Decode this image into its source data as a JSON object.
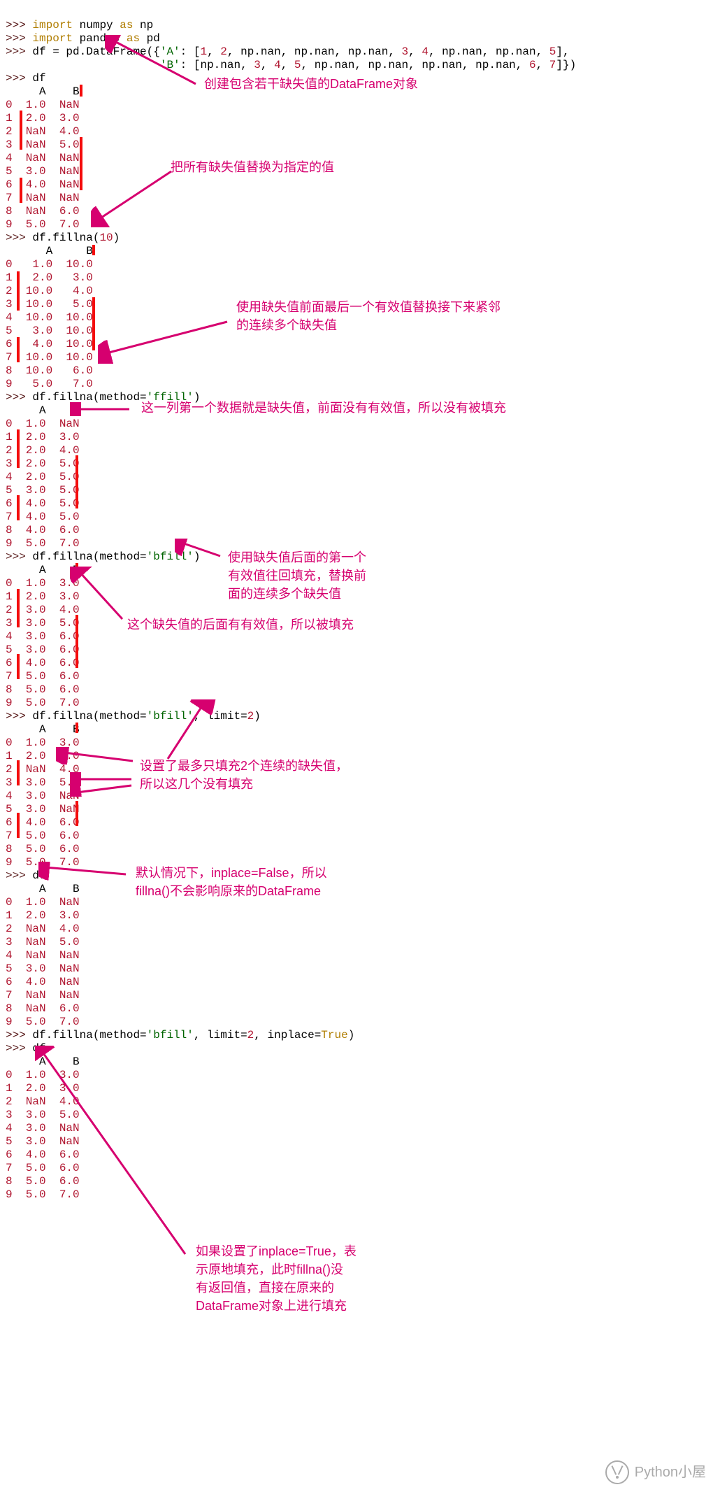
{
  "code": {
    "line01": ">>> import numpy as np",
    "line02": ">>> import pandas as pd",
    "line03a": ">>> df = pd.DataFrame({'A': [1, 2, np.nan, np.nan, np.nan, 3, 4, np.nan, np.nan, 5],",
    "line03b": "                       'B': [np.nan, 3, 4, 5, np.nan, np.nan, np.nan, np.nan, 6, 7]})",
    "cmd_df": ">>> df",
    "cmd_fillna10": ">>> df.fillna(10)",
    "cmd_ffill": ">>> df.fillna(method='ffill')",
    "cmd_bfill": ">>> df.fillna(method='bfill')",
    "cmd_bfill_lim": ">>> df.fillna(method='bfill', limit=2)",
    "cmd_bfill_inplace": ">>> df.fillna(method='bfill', limit=2, inplace=True)"
  },
  "tables": {
    "df_orig": {
      "header": "     A    B",
      "rows": [
        "0  1.0  NaN",
        "1  2.0  3.0",
        "2  NaN  4.0",
        "3  NaN  5.0",
        "4  NaN  NaN",
        "5  3.0  NaN",
        "6  4.0  NaN",
        "7  NaN  NaN",
        "8  NaN  6.0",
        "9  5.0  7.0"
      ]
    },
    "df_fill10": {
      "header": "      A     B",
      "rows": [
        "0   1.0  10.0",
        "1   2.0   3.0",
        "2  10.0   4.0",
        "3  10.0   5.0",
        "4  10.0  10.0",
        "5   3.0  10.0",
        "6   4.0  10.0",
        "7  10.0  10.0",
        "8  10.0   6.0",
        "9   5.0   7.0"
      ]
    },
    "df_ffill": {
      "header": "     A    B",
      "rows": [
        "0  1.0  NaN",
        "1  2.0  3.0",
        "2  2.0  4.0",
        "3  2.0  5.0",
        "4  2.0  5.0",
        "5  3.0  5.0",
        "6  4.0  5.0",
        "7  4.0  5.0",
        "8  4.0  6.0",
        "9  5.0  7.0"
      ]
    },
    "df_bfill": {
      "header": "     A    B",
      "rows": [
        "0  1.0  3.0",
        "1  2.0  3.0",
        "2  3.0  4.0",
        "3  3.0  5.0",
        "4  3.0  6.0",
        "5  3.0  6.0",
        "6  4.0  6.0",
        "7  5.0  6.0",
        "8  5.0  6.0",
        "9  5.0  7.0"
      ]
    },
    "df_bfill_lim": {
      "header": "     A    B",
      "rows": [
        "0  1.0  3.0",
        "1  2.0  3.0",
        "2  NaN  4.0",
        "3  3.0  5.0",
        "4  3.0  NaN",
        "5  3.0  NaN",
        "6  4.0  6.0",
        "7  5.0  6.0",
        "8  5.0  6.0",
        "9  5.0  7.0"
      ]
    },
    "df_again": {
      "header": "     A    B",
      "rows": [
        "0  1.0  NaN",
        "1  2.0  3.0",
        "2  NaN  4.0",
        "3  NaN  5.0",
        "4  NaN  NaN",
        "5  3.0  NaN",
        "6  4.0  NaN",
        "7  NaN  NaN",
        "8  NaN  6.0",
        "9  5.0  7.0"
      ]
    },
    "df_inplace": {
      "header": "     A    B",
      "rows": [
        "0  1.0  3.0",
        "1  2.0  3.0",
        "2  NaN  4.0",
        "3  3.0  5.0",
        "4  3.0  NaN",
        "5  3.0  NaN",
        "6  4.0  6.0",
        "7  5.0  6.0",
        "8  5.0  6.0",
        "9  5.0  7.0"
      ]
    }
  },
  "annotations": {
    "a1": "创建包含若干缺失值的DataFrame对象",
    "a2": "把所有缺失值替换为指定的值",
    "a3": "使用缺失值前面最后一个有效值替换接下来紧邻\n的连续多个缺失值",
    "a4": "这一列第一个数据就是缺失值，前面没有有效值，所以没有被填充",
    "a5": "使用缺失值后面的第一个\n有效值往回填充，替换前\n面的连续多个缺失值",
    "a6": "这个缺失值的后面有有效值，所以被填充",
    "a7": "设置了最多只填充2个连续的缺失值，\n所以这几个没有填充",
    "a8": "默认情况下，inplace=False，所以\nfillna()不会影响原来的DataFrame",
    "a9": "如果设置了inplace=True，表\n示原地填充，此时fillna()没\n有返回值，直接在原来的\nDataFrame对象上进行填充"
  },
  "watermark": "Python小屋"
}
